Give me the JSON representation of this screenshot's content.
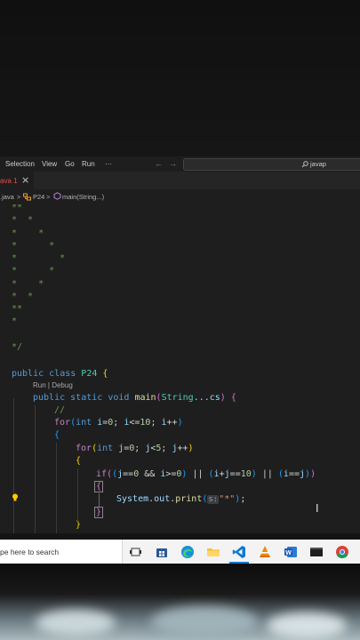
{
  "menubar": {
    "items": [
      "Selection",
      "View",
      "Go",
      "Run",
      "···"
    ],
    "nav_back": "←",
    "nav_forward": "→",
    "search_text": "javap"
  },
  "tab": {
    "name": "ava",
    "modified_mark": "1",
    "close": "×"
  },
  "breadcrumb": {
    "file": ".java",
    "class": "P24",
    "method": "main(String...)"
  },
  "editor": {
    "codelens": "Run | Debug",
    "pattern_lines": [
      "**",
      "*  *",
      "*    *",
      "*      *",
      "*        *",
      "*      *",
      "*    *",
      "*  *",
      "**",
      "*"
    ],
    "comment_end": "*/",
    "class_decl": [
      "public",
      "class",
      "P24",
      "{"
    ],
    "main_decl": [
      "public",
      "static",
      "void",
      "main",
      "String",
      "...cs",
      "{"
    ],
    "comment_inline": "//",
    "outer_for": [
      "for",
      "int",
      "i",
      "0",
      "i",
      "10",
      "i"
    ],
    "inner_for": [
      "for",
      "int",
      "j",
      "0",
      "j",
      "5",
      "j"
    ],
    "if_stmt": [
      "if",
      "j",
      "0",
      "i",
      "0",
      "i",
      "j",
      "10",
      "i",
      "j"
    ],
    "print_stmt": [
      "System",
      "out",
      "print",
      "s:",
      "\"*\""
    ]
  },
  "taskbar": {
    "search_placeholder": "pe here to search",
    "icons": [
      "task-view-icon",
      "store-icon",
      "edge-icon",
      "file-explorer-icon",
      "vscode-icon",
      "vlc-icon",
      "word-icon",
      "terminal-icon",
      "chrome-icon"
    ]
  }
}
